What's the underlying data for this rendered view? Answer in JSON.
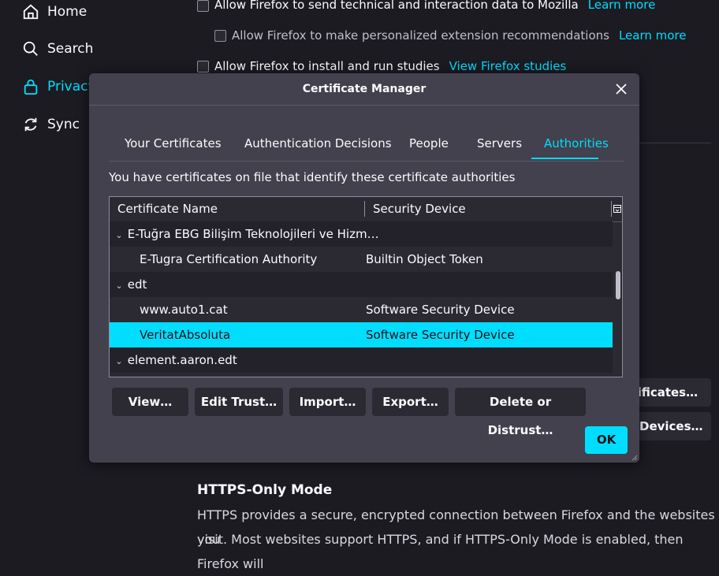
{
  "sidebar": {
    "items": [
      {
        "label": "Home"
      },
      {
        "label": "Search"
      },
      {
        "label": "Privacy"
      },
      {
        "label": "Sync"
      }
    ]
  },
  "background": {
    "opt1": "Allow Firefox to send technical and interaction data to Mozilla",
    "opt1_link": "Learn more",
    "opt2": "Allow Firefox to make personalized extension recommendations",
    "opt2_link": "Learn more",
    "opt3": "Allow Firefox to install and run studies",
    "opt3_link": "View Firefox studies",
    "btn_certificates": "rtificates…",
    "btn_devices": "y Devices…",
    "https_heading": "HTTPS-Only Mode",
    "https_line1": "HTTPS provides a secure, encrypted connection between Firefox and the websites you",
    "https_line2": "visit. Most websites support HTTPS, and if HTTPS-Only Mode is enabled, then Firefox will"
  },
  "dialog": {
    "title": "Certificate Manager",
    "tabs": [
      {
        "label": "Your Certificates"
      },
      {
        "label": "Authentication Decisions"
      },
      {
        "label": "People"
      },
      {
        "label": "Servers"
      },
      {
        "label": "Authorities"
      }
    ],
    "selected_tab": "Authorities",
    "description": "You have certificates on file that identify these certificate authorities",
    "columns": [
      "Certificate Name",
      "Security Device"
    ],
    "rows": [
      {
        "name": "E-Tuğra EBG Bilişim Teknolojileri ve Hizm…",
        "device": "",
        "group": true
      },
      {
        "name": "E-Tugra Certification Authority",
        "device": "Builtin Object Token",
        "group": false
      },
      {
        "name": "edt",
        "device": "",
        "group": true
      },
      {
        "name": "www.auto1.cat",
        "device": "Software Security Device",
        "group": false
      },
      {
        "name": "VeritatAbsoluta",
        "device": "Software Security Device",
        "group": false,
        "selected": true
      },
      {
        "name": "element.aaron.edt",
        "device": "",
        "group": true
      }
    ],
    "buttons": {
      "view": "View…",
      "edit_trust": "Edit Trust…",
      "import": "Import…",
      "export": "Export…",
      "delete": "Delete or Distrust…"
    },
    "ok": "OK"
  },
  "colors": {
    "accent": "#00ddff",
    "background": "#1c1b22",
    "dialog": "#42414d"
  }
}
